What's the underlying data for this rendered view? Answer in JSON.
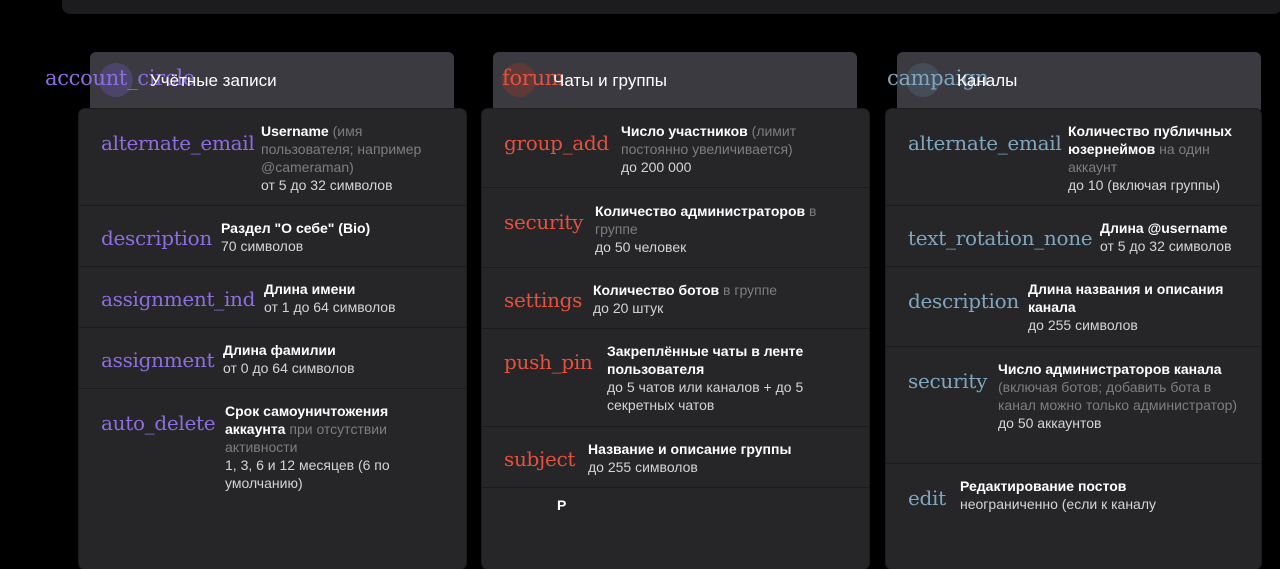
{
  "colors": {
    "purple": "#8d6de0",
    "red": "#e5503f",
    "teal": "#7fa6bf",
    "card_bg": "#262628",
    "header_bg": "#3b3a40"
  },
  "columns": [
    {
      "header": {
        "icon": "account_circle",
        "title": "Учётные записи"
      },
      "rows": [
        {
          "icon": "alternate_email",
          "title": "Username",
          "note": " (имя пользователя; например @cameraman)",
          "value": "от 5 до 32 символов"
        },
        {
          "icon": "description",
          "title": "Раздел \"О себе\" (Bio)",
          "note": "",
          "value": "70 символов"
        },
        {
          "icon": "assignment_ind",
          "title": "Длина имени",
          "note": "",
          "value": "от 1 до 64 символов"
        },
        {
          "icon": "assignment",
          "title": "Длина фамилии",
          "note": "",
          "value": "от 0 до 64 символов"
        },
        {
          "icon": "auto_delete",
          "title": "Срок самоуничтожения аккаунта",
          "note": " при отсутствии активности",
          "value": "1, 3, 6 и 12 месяцев (6 по умолчанию)"
        }
      ]
    },
    {
      "header": {
        "icon": "forum",
        "title": "Чаты и группы"
      },
      "rows": [
        {
          "icon": "group_add",
          "title": "Число участников",
          "note": " (лимит постоянно увеличивается)",
          "value": "до 200 000"
        },
        {
          "icon": "security",
          "title": "Количество администраторов",
          "note": " в группе",
          "value": "до 50 человек"
        },
        {
          "icon": "settings",
          "title": "Количество ботов",
          "note": " в группе",
          "value": "до 20 штук"
        },
        {
          "icon": "push_pin",
          "title": "Закреплённые чаты в ленте пользователя",
          "note": "",
          "value": "до 5 чатов или каналов + до 5 секретных чатов"
        },
        {
          "icon": "subject",
          "title": "Название и описание группы",
          "note": "",
          "value": "до 255 символов"
        },
        {
          "icon": "",
          "title": "Р",
          "note": "",
          "value": ""
        }
      ]
    },
    {
      "header": {
        "icon": "campaign",
        "title": "Каналы"
      },
      "rows": [
        {
          "icon": "alternate_email",
          "title": "Количество публичных юзернеймов",
          "note": " на один аккаунт",
          "value": "до 10 (включая группы)"
        },
        {
          "icon": "text_rotation_none",
          "title": "Длина @username",
          "note": "",
          "value": "от 5 до 32 символов"
        },
        {
          "icon": "description",
          "title": "Длина названия и описания канала",
          "note": "",
          "value": "до 255 символов"
        },
        {
          "icon": "security",
          "title": "Число администраторов канала",
          "note": " (включая ботов; добавить бота в канал можно только администратор)",
          "value": "до 50 аккаунтов"
        },
        {
          "icon": "edit",
          "title": "Редактирование постов",
          "note": "",
          "value": "неограниченно (если к каналу"
        }
      ]
    }
  ]
}
